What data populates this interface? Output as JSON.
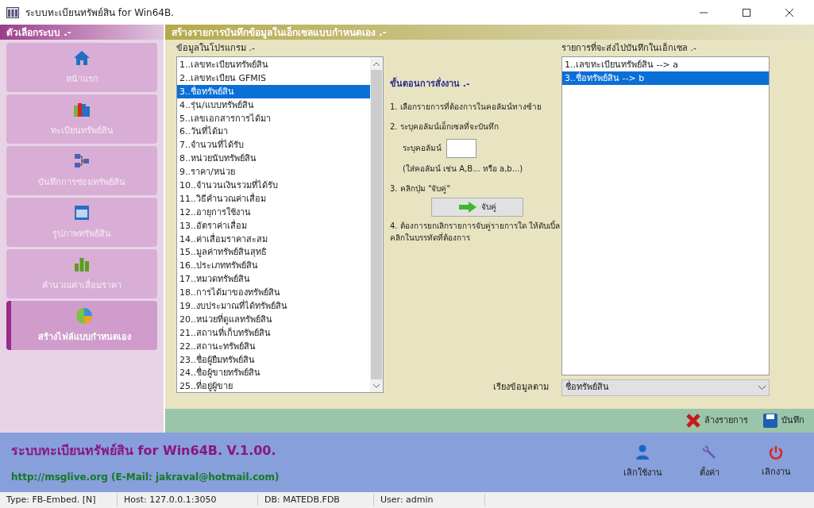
{
  "window": {
    "title": "ระบบทะเบียนทรัพย์สิน for Win64B."
  },
  "sidebar": {
    "title": "ตัวเลือกระบบ .-",
    "items": [
      {
        "kind": "home",
        "label": "หน้าแรก",
        "selected": false
      },
      {
        "kind": "books",
        "label": "ทะเบียนทรัพย์สิน",
        "selected": false
      },
      {
        "kind": "flow",
        "label": "บันทึกการซ่อมทรัพย์สิน",
        "selected": false
      },
      {
        "kind": "news",
        "label": "รูปภาพทรัพย์สิน",
        "selected": false
      },
      {
        "kind": "bars",
        "label": "คำนวณค่าเสื่อมราคา",
        "selected": false
      },
      {
        "kind": "pie",
        "label": "สร้างไฟล์แบบกำหนดเอง",
        "selected": true
      }
    ]
  },
  "panel": {
    "title": "สร้างรายการบันทึกข้อมูลในเอ็กเซลแบบกำหนดเอง .-",
    "source": {
      "label": "ข้อมูลในโปรแกรม .-",
      "items": [
        {
          "text": "1..เลขทะเบียนทรัพย์สิน",
          "selected": false
        },
        {
          "text": "2..เลขทะเบียน GFMIS",
          "selected": false
        },
        {
          "text": "3..ชื่อทรัพย์สิน",
          "selected": true
        },
        {
          "text": "4..รุ่น/แบบทรัพย์สิน",
          "selected": false
        },
        {
          "text": "5..เลขเอกสารการได้มา",
          "selected": false
        },
        {
          "text": "6..วันที่ได้มา",
          "selected": false
        },
        {
          "text": "7..จำนวนที่ได้รับ",
          "selected": false
        },
        {
          "text": "8..หน่วยนับทรัพย์สิน",
          "selected": false
        },
        {
          "text": "9..ราคา/หน่วย",
          "selected": false
        },
        {
          "text": "10..จำนวนเงินรวมที่ได้รับ",
          "selected": false
        },
        {
          "text": "11..วิธีคำนวณค่าเสื่อม",
          "selected": false
        },
        {
          "text": "12..อายุการใช้งาน",
          "selected": false
        },
        {
          "text": "13..อัตราค่าเสื่อม",
          "selected": false
        },
        {
          "text": "14..ค่าเสื่อมราคาสะสม",
          "selected": false
        },
        {
          "text": "15..มูลค่าทรัพย์สินสุทธิ",
          "selected": false
        },
        {
          "text": "16..ประเภททรัพย์สิน",
          "selected": false
        },
        {
          "text": "17..หมวดทรัพย์สิน",
          "selected": false
        },
        {
          "text": "18..การได้มาของทรัพย์สิน",
          "selected": false
        },
        {
          "text": "19..งบประมาณที่ได้ทรัพย์สิน",
          "selected": false
        },
        {
          "text": "20..หน่วยที่ดูแลทรัพย์สิน",
          "selected": false
        },
        {
          "text": "21..สถานที่เก็บทรัพย์สิน",
          "selected": false
        },
        {
          "text": "22..สถานะทรัพย์สิน",
          "selected": false
        },
        {
          "text": "23..ชื่อผู้ยืมทรัพย์สิน",
          "selected": false
        },
        {
          "text": "24..ชื่อผู้ขายทรัพย์สิน",
          "selected": false
        },
        {
          "text": "25..ที่อยู่ผู้ขาย",
          "selected": false
        }
      ]
    },
    "steps": {
      "title": "ขั้นตอนการสั่งงาน .-",
      "step_1": "1. เลือกรายการที่ต้องการในคอลัมน์ทางซ้าย",
      "step_2": "2. ระบุคอลัมน์เอ็กเซลที่จะบันทึก",
      "column_label": "ระบุคอลัมน์",
      "column_hint": "(ใส่คอลัมน์ เช่น A,B... หรือ a,b...)",
      "step_3": "3. คลิกปุ่ม \"จับคู่\"",
      "pair_button": "จับคู่",
      "step_4": "4. ต้องการยกเลิกรายการจับคู่รายการใด ให้ดับเบิ้ลคลิกในบรรทัดที่ต้องการ"
    },
    "target": {
      "label": "รายการที่จะส่งไปบันทึกในเอ็กเซล .-",
      "items": [
        {
          "text": "1..เลขทะเบียนทรัพย์สิน --> a",
          "selected": false
        },
        {
          "text": "3..ชื่อทรัพย์สิน --> b",
          "selected": true
        }
      ]
    },
    "sort": {
      "label": "เรียงข้อมูลตาม",
      "value": "ชื่อทรัพย์สิน"
    }
  },
  "toolbar": [
    {
      "kind": "clear",
      "label": "ล้างรายการ"
    },
    {
      "kind": "save",
      "label": "บันทึก"
    }
  ],
  "footer": {
    "title": "ระบบทะเบียนทรัพย์สิน for Win64B. V.1.00.",
    "contact": "http://msglive.org (E-Mail: jakraval@hotmail.com)",
    "buttons": [
      {
        "kind": "user",
        "label": "เลิกใช้งาน"
      },
      {
        "kind": "settings",
        "label": "ตั้งค่า"
      },
      {
        "kind": "power",
        "label": "เลิกงาน"
      }
    ]
  },
  "status_bar": [
    "Type: FB-Embed. [N]",
    "Host: 127.0.0.1:3050",
    "DB: MATEDB.FDB",
    "User: admin"
  ]
}
